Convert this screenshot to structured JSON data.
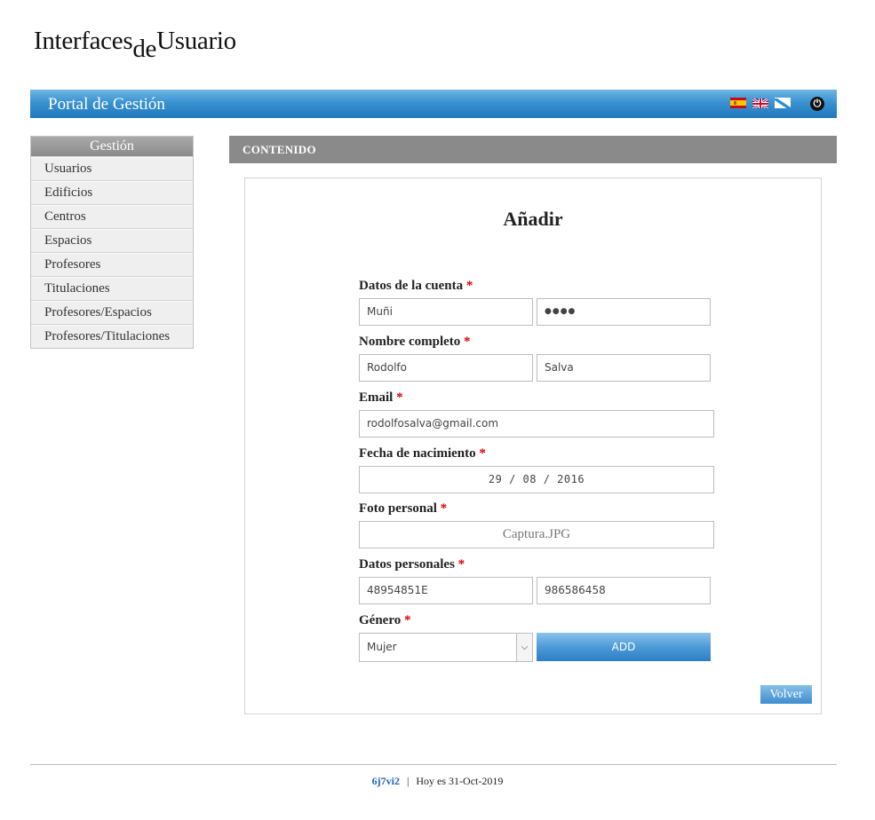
{
  "logo": {
    "part1": "Interfaces",
    "part2": "de",
    "part3": "Usuario"
  },
  "topbar": {
    "title": "Portal de Gestión",
    "icons": [
      "flag-spain-icon",
      "flag-uk-icon",
      "flag-galicia-icon",
      "power-icon"
    ]
  },
  "sidebar": {
    "title": "Gestión",
    "items": [
      "Usuarios",
      "Edificios",
      "Centros",
      "Espacios",
      "Profesores",
      "Titulaciones",
      "Profesores/Espacios",
      "Profesores/Titulaciones"
    ]
  },
  "content": {
    "header": "CONTENIDO",
    "title": "Añadir",
    "required_mark": "*",
    "fields": {
      "cuenta": {
        "label": "Datos de la cuenta",
        "user": "Muñi",
        "password": "●●●●"
      },
      "nombre": {
        "label": "Nombre completo",
        "first": "Rodolfo",
        "last": "Salva"
      },
      "email": {
        "label": "Email",
        "value": "rodolfosalva@gmail.com"
      },
      "fecha": {
        "label": "Fecha de nacimiento",
        "value": "29 / 08 / 2016"
      },
      "foto": {
        "label": "Foto personal",
        "value": "Captura.JPG"
      },
      "personales": {
        "label": "Datos personales",
        "dni": "48954851E",
        "phone": "986586458"
      },
      "genero": {
        "label": "Género",
        "selected": "Mujer"
      }
    },
    "add_button": "ADD",
    "back_button": "Volver"
  },
  "footer": {
    "user": "6j7vi2",
    "separator": "|",
    "date_text": "Hoy es 31-Oct-2019"
  },
  "colors": {
    "accent": "#2f86c9",
    "required": "#dd0000",
    "header_gray": "#8a8a8a"
  }
}
